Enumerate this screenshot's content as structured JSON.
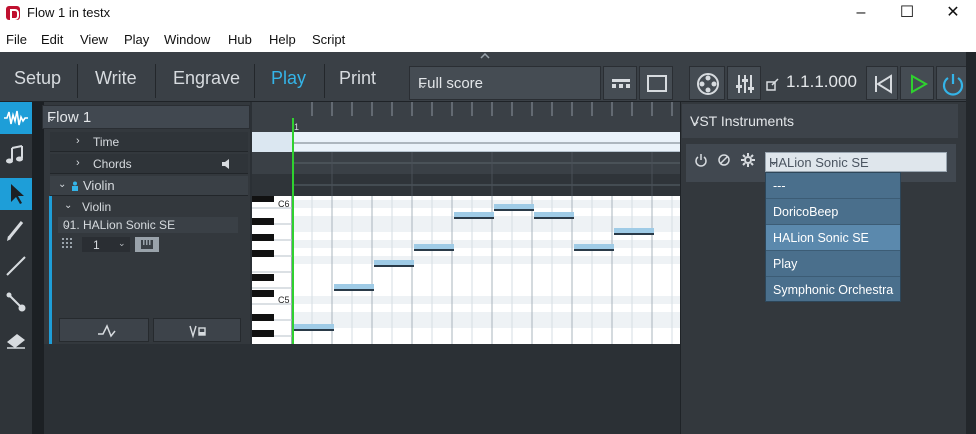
{
  "window": {
    "title": "Flow 1 in testx",
    "minimize_glyph": "–",
    "maximize_glyph": "☐",
    "close_glyph": "✕"
  },
  "menu": [
    "File",
    "Edit",
    "View",
    "Play",
    "Window",
    "Hub",
    "Help",
    "Script"
  ],
  "modes": {
    "setup": "Setup",
    "write": "Write",
    "engrave": "Engrave",
    "play": "Play",
    "print": "Print",
    "active": "Play"
  },
  "layout_select": {
    "value": "Full score"
  },
  "transport": {
    "position": "1.1.1.000"
  },
  "flow_select": {
    "value": "Flow 1"
  },
  "tracks": {
    "time": "Time",
    "chords": "Chords",
    "instrument": "Violin",
    "instrument_sub": "Violin",
    "instrument_plugin": "01. HALion Sonic SE",
    "channel": "1"
  },
  "piano_roll": {
    "ruler_marker": "1",
    "key_labels": [
      "C6",
      "C5"
    ]
  },
  "vst_panel": {
    "title": "VST Instruments",
    "selected_plugin": "HALion Sonic SE",
    "options": [
      "---",
      "DoricoBeep",
      "HALion Sonic SE",
      "Play",
      "Symphonic Orchestra"
    ],
    "highlighted_option": "HALion Sonic SE"
  },
  "colors": {
    "accent": "#34b4e8",
    "playhead": "#2fd12f",
    "note": "#9fcbe6",
    "dropdown_bg": "#4a6f8c"
  }
}
